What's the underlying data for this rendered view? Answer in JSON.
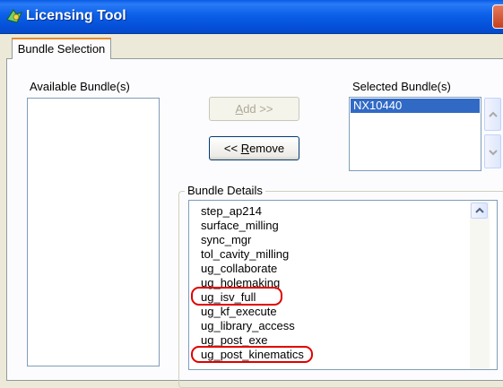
{
  "window": {
    "title": "Licensing Tool"
  },
  "tabs": [
    {
      "label": "Bundle Selection"
    }
  ],
  "available": {
    "label": "Available Bundle(s)",
    "items": []
  },
  "selected": {
    "label": "Selected Bundle(s)",
    "items": [
      "NX10440"
    ]
  },
  "buttons": {
    "add": {
      "accel": "A",
      "rest": "dd >>",
      "enabled": false
    },
    "remove": {
      "prefix": "<< ",
      "accel": "R",
      "rest": "emove",
      "enabled": true
    }
  },
  "details": {
    "label": "Bundle Details",
    "items": [
      "step_ap214",
      "surface_milling",
      "sync_mgr",
      "tol_cavity_milling",
      "ug_collaborate",
      "ug_holemaking",
      "ug_isv_full",
      "ug_kf_execute",
      "ug_library_access",
      "ug_post_exe",
      "ug_post_kinematics"
    ],
    "highlighted": [
      "ug_isv_full",
      "ug_post_kinematics"
    ]
  },
  "colors": {
    "titlebar": "#0b5fe8",
    "selection": "#316ac5",
    "annotation": "#e00000",
    "window_bg": "#ece9d8"
  }
}
